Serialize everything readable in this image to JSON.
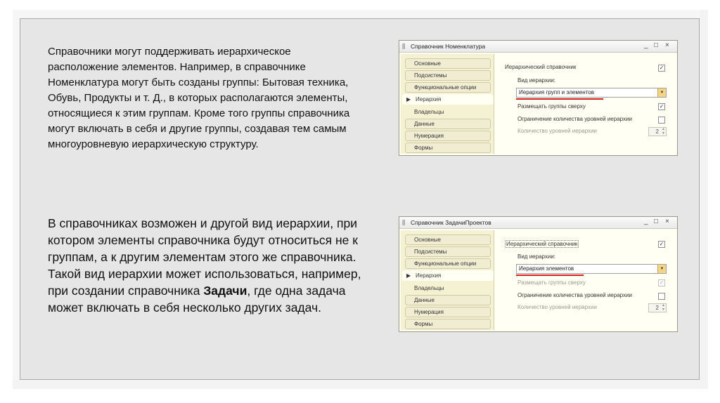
{
  "paragraph1": "Справочники могут поддерживать иерархическое расположение элементов. Например, в справочнике Номенклатура могут быть созданы группы: Бытовая техника, Обувь, Продукты и т. Д., в которых располагаются элементы, относящиеся к этим группам. Кроме того группы справочника могут включать в себя и другие группы, создавая тем самым многоуровневую иерархическую структуру.",
  "paragraph2": {
    "before": "В справочниках возможен и другой вид иерархии, при котором элементы справочника будут относиться не к группам, а к другим элементам этого же справочника. Такой вид иерархии может использоваться, например, при создании справочника ",
    "bold": "Задачи",
    "after": ", где одна задача может включать в себя несколько других задач."
  },
  "window1": {
    "title": "Справочник Номенклатура",
    "controls": [
      "_",
      "□",
      "×"
    ],
    "tabs": [
      "Основные",
      "Подсистемы",
      "Функциональные опции",
      "Иерархия",
      "Владельцы",
      "Данные",
      "Нумерация",
      "Формы"
    ],
    "active_tab": "Иерархия",
    "hierarchical_label": "Иерархический справочник",
    "hierarchical_checked": "✓",
    "type_label": "Вид иерархии:",
    "type_value": "Иерархия групп и элементов",
    "groups_top_label": "Размещать группы сверху",
    "groups_top_checked": "✓",
    "limit_label": "Ограничение количества уровней иерархии",
    "limit_checked": "",
    "levels_label": "Количество уровней иерархии",
    "levels_value": "2"
  },
  "window2": {
    "title": "Справочник ЗадачиПроектов",
    "controls": [
      "_",
      "□",
      "×"
    ],
    "tabs": [
      "Основные",
      "Подсистемы",
      "Функциональные опции",
      "Иерархия",
      "Владельцы",
      "Данные",
      "Нумерация",
      "Формы"
    ],
    "active_tab": "Иерархия",
    "hierarchical_label": "Иерархический справочник",
    "hierarchical_checked": "✓",
    "type_label": "Вид иерархии:",
    "type_value": "Иерархия элементов",
    "groups_top_label": "Размещать группы сверху",
    "groups_top_checked": "✓",
    "limit_label": "Ограничение количества уровней иерархии",
    "limit_checked": "",
    "levels_label": "Количество уровней иерархии",
    "levels_value": "2"
  },
  "colors": {
    "slide_bg": "#e6e6e6",
    "sidebar": "#f5f1d3",
    "underline": "#d42020",
    "dropdown": "#f1d68a"
  }
}
